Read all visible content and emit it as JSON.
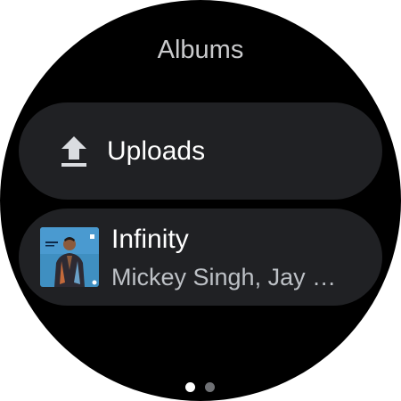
{
  "header": {
    "title": "Albums"
  },
  "uploads": {
    "label": "Uploads",
    "icon": "upload-icon"
  },
  "album": {
    "title": "Infinity",
    "artist": "Mickey Singh, Jay …",
    "art_icon": "album-art"
  },
  "pager": {
    "pages": 2,
    "current": 1
  },
  "colors": {
    "background": "#000000",
    "chip": "#202124",
    "primary_text": "#ffffff",
    "secondary_text": "#bdc1c6",
    "title_text": "#c9cacc"
  }
}
